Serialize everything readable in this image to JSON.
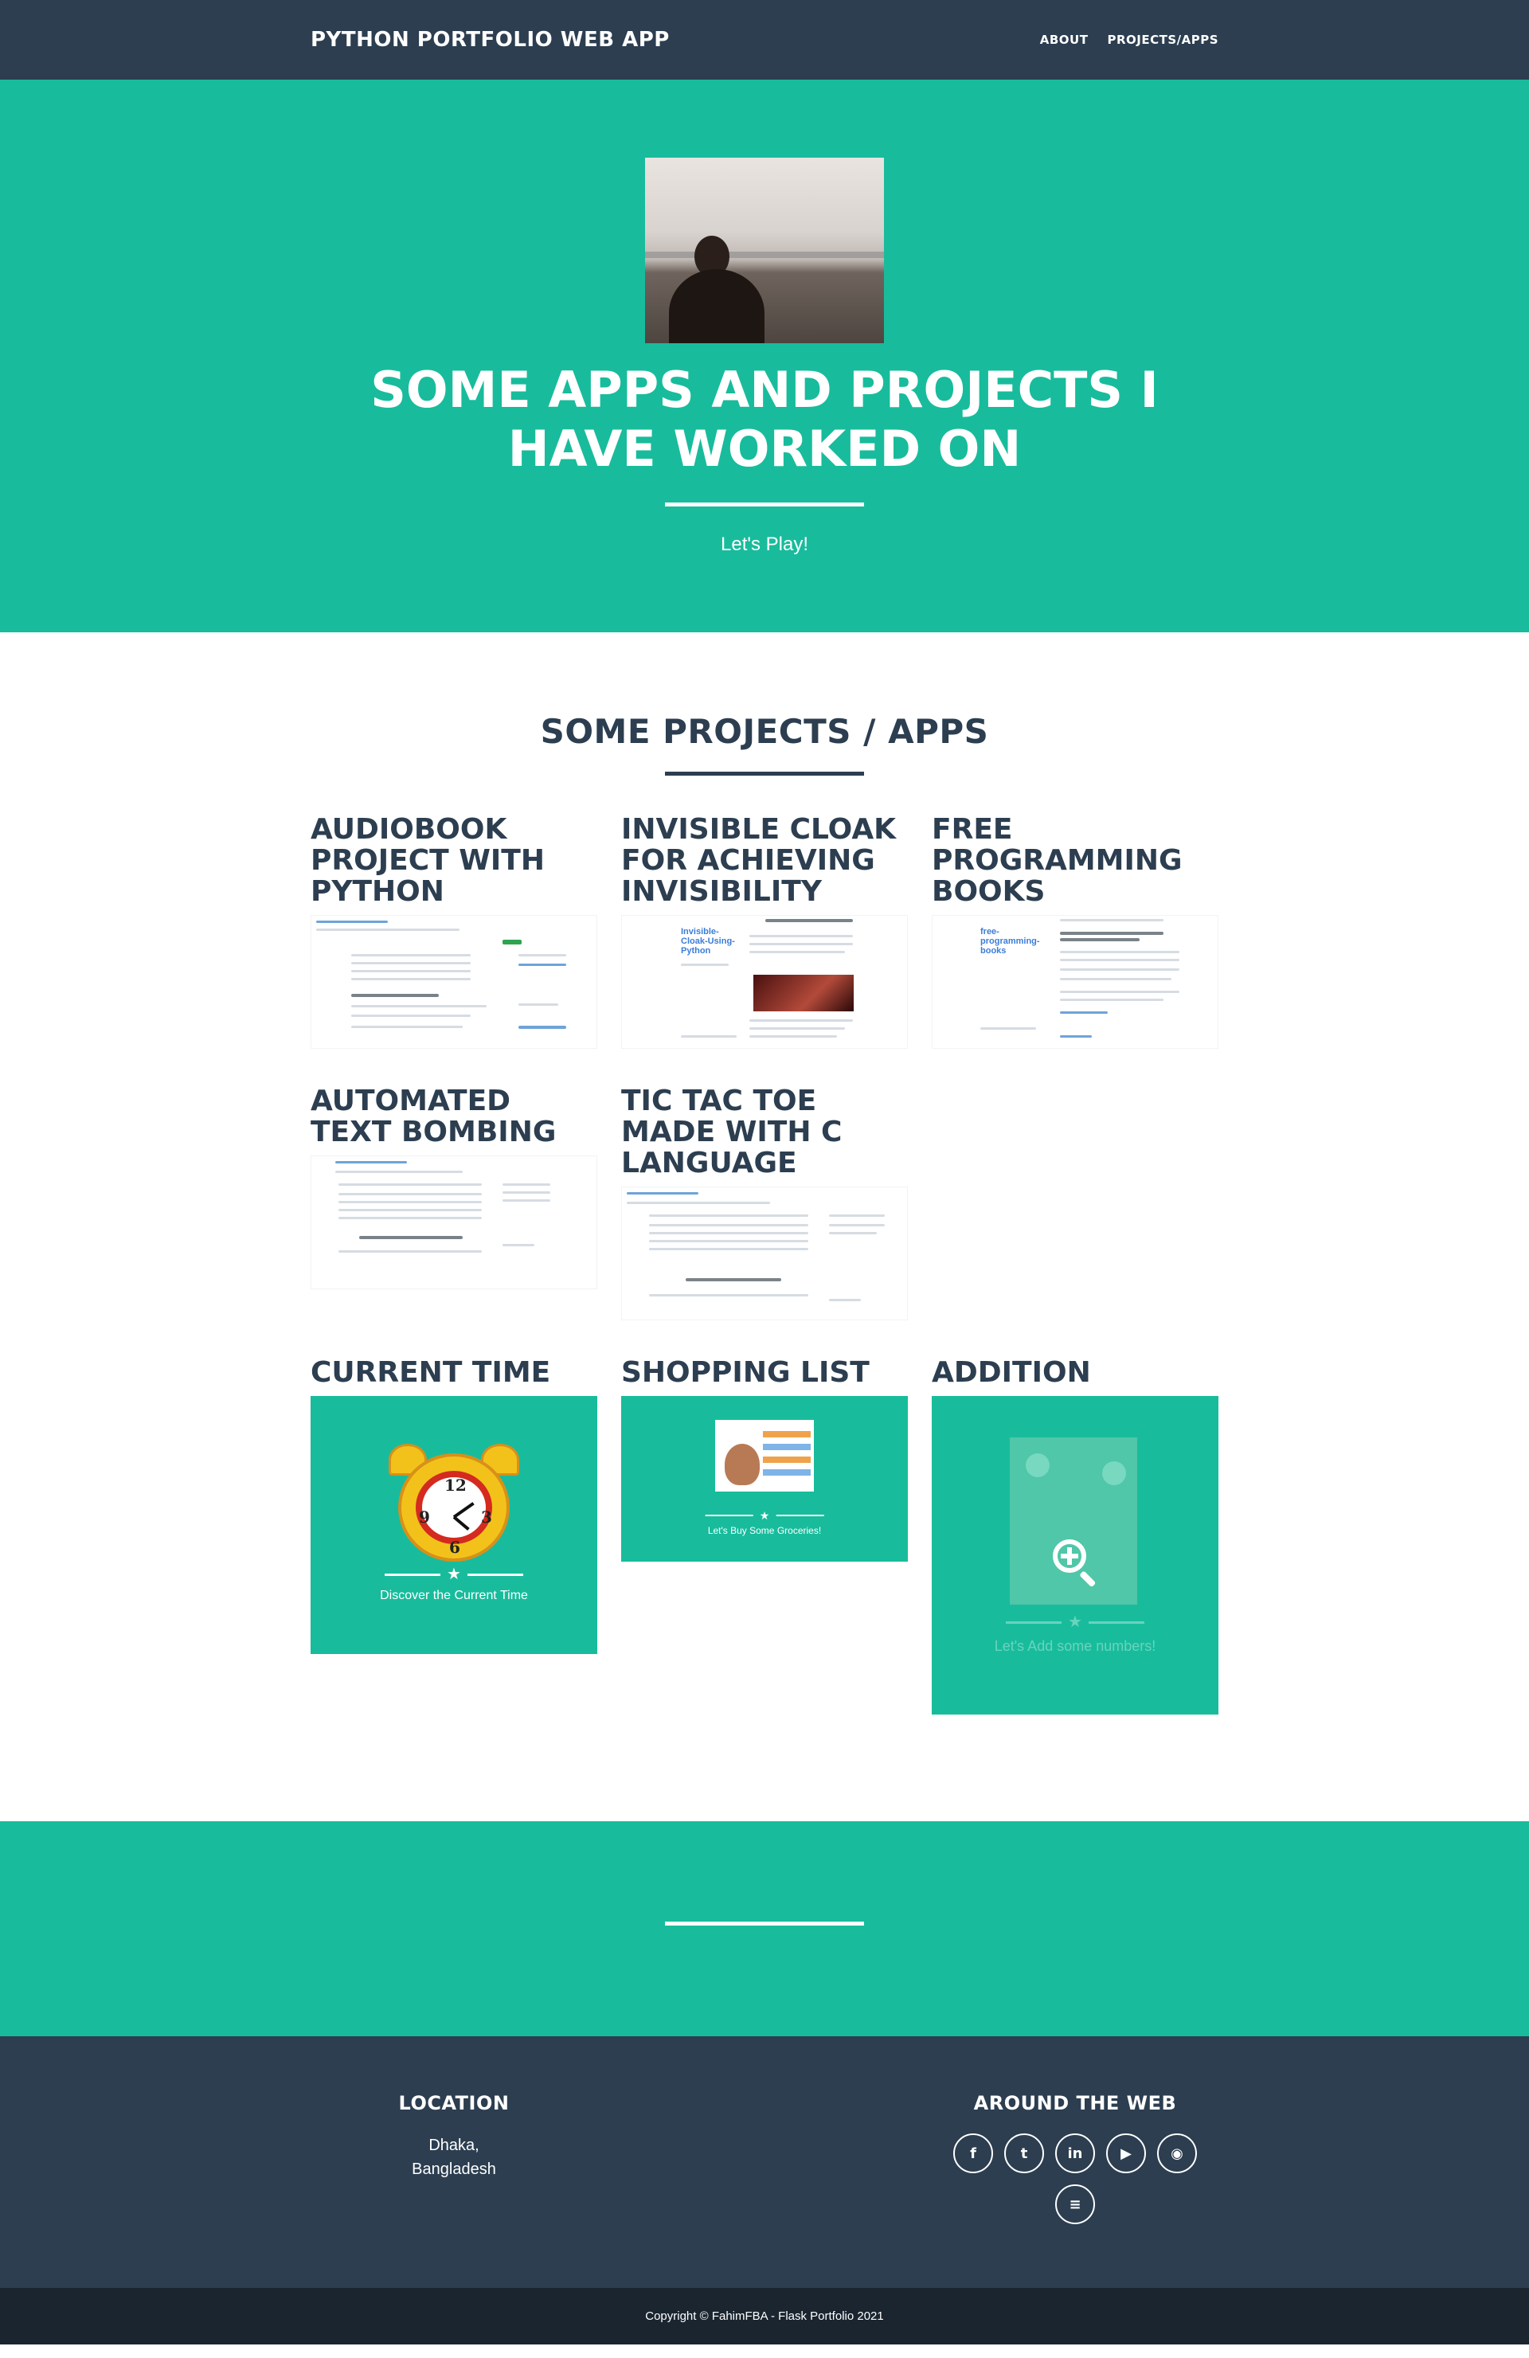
{
  "nav": {
    "brand": "PYTHON PORTFOLIO WEB APP",
    "links": [
      "ABOUT",
      "PROJECTS/APPS"
    ]
  },
  "hero": {
    "title": "SOME APPS AND PROJECTS I HAVE WORKED ON",
    "subtitle": "Let's Play!"
  },
  "projects": {
    "title": "SOME PROJECTS / APPS",
    "items": [
      {
        "title": "AUDIOBOOK PROJECT WITH PYTHON",
        "shot_heading": "Audiobook Project with Python"
      },
      {
        "title": "INVISIBLE CLOAK FOR ACHIEVING INVISIBILITY",
        "shot_heading": "Invisible Cloak for Achieving Invisibility",
        "shot_logo": "Invisible-Cloak-Using-Python"
      },
      {
        "title": "FREE PROGRAMMING BOOKS",
        "shot_heading": "List of Free Learning Resources In Many Languages",
        "shot_logo": "free-programming-books"
      },
      {
        "title": "AUTOMATED TEXT BOMBING",
        "shot_heading": "Tic Tac Toe Made with C Language"
      },
      {
        "title": "TIC TAC TOE MADE WITH C LANGUAGE",
        "shot_heading": "Tic Tac Toe Made with C Language"
      },
      {
        "title": "CURRENT TIME",
        "caption": "Discover the Current Time"
      },
      {
        "title": "SHOPPING LIST",
        "caption": "Let's Buy Some Groceries!"
      },
      {
        "title": "ADDITION",
        "caption": "Let's Add some numbers!"
      }
    ]
  },
  "footer": {
    "location_title": "LOCATION",
    "location_lines": [
      "Dhaka,",
      "Bangladesh"
    ],
    "web_title": "AROUND THE WEB",
    "social_icons": [
      "facebook-icon",
      "twitter-icon",
      "linkedin-icon",
      "youtube-icon",
      "github-icon",
      "stackoverflow-icon"
    ],
    "social_glyphs": [
      "f",
      "t",
      "in",
      "▶",
      "◉",
      "≡"
    ],
    "copyright": "Copyright © FahimFBA - Flask Portfolio 2021"
  },
  "colors": {
    "primary": "#2c3e50",
    "accent": "#18bc9c",
    "footer_bottom": "#1a252f"
  }
}
